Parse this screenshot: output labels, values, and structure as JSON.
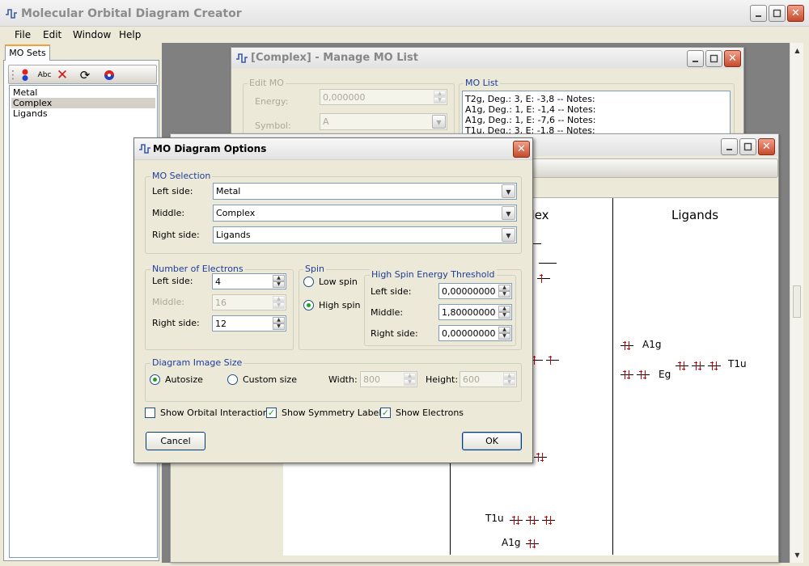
{
  "app": {
    "title": "Molecular Orbital Diagram Creator"
  },
  "menu": [
    "File",
    "Edit",
    "Window",
    "Help"
  ],
  "left_panel": {
    "tab": "MO Sets",
    "toolbar": {
      "abc_label": "Abc"
    },
    "sets": [
      "Metal",
      "Complex",
      "Ligands"
    ],
    "selected": "Complex"
  },
  "manage_window": {
    "title": "[Complex] - Manage MO List",
    "edit_group": "Edit MO",
    "energy_label": "Energy:",
    "energy_value": "0,000000",
    "symbol_label": "Symbol:",
    "symbol_value": "A",
    "list_group": "MO List",
    "mo_list": [
      "T2g, Deg.: 3, E: -3,8  -- Notes:",
      "A1g, Deg.: 1, E: -1,4  -- Notes:",
      "A1g, Deg.: 1, E: -7,6  -- Notes:",
      "T1u, Deg.: 3, E: -1,8  -- Notes:"
    ]
  },
  "diagram": {
    "headings": {
      "middle": "plex",
      "right": "Ligands"
    },
    "labels": {
      "a1g_right": "A1g",
      "eg_right": "Eg",
      "t1u_right": "T1u",
      "t1u_bottom": "T1u",
      "a1g_bottom": "A1g"
    }
  },
  "dialog": {
    "title": "MO Diagram Options",
    "mo_selection": {
      "title": "MO Selection",
      "left_label": "Left side:",
      "left_value": "Metal",
      "middle_label": "Middle:",
      "middle_value": "Complex",
      "right_label": "Right side:",
      "right_value": "Ligands"
    },
    "electrons": {
      "title": "Number of Electrons",
      "left_label": "Left side:",
      "left_value": "4",
      "middle_label": "Middle:",
      "middle_value": "16",
      "right_label": "Right side:",
      "right_value": "12"
    },
    "spin": {
      "title": "Spin",
      "low_label": "Low spin",
      "high_label": "High spin",
      "selected": "High spin",
      "threshold_title": "High Spin Energy Threshold",
      "left_label": "Left side:",
      "left_value": "0,00000000",
      "middle_label": "Middle:",
      "middle_value": "1,80000000",
      "right_label": "Right side:",
      "right_value": "0,00000000"
    },
    "image_size": {
      "title": "Diagram Image Size",
      "autosize_label": "Autosize",
      "custom_label": "Custom size",
      "selected": "Autosize",
      "width_label": "Width:",
      "width_value": "800",
      "height_label": "Height:",
      "height_value": "600"
    },
    "checks": {
      "interactions_label": "Show Orbital Interactions",
      "interactions": false,
      "symmetry_label": "Show Symmetry Labels",
      "symmetry": true,
      "electrons_label": "Show Electrons",
      "electrons": true
    },
    "cancel_label": "Cancel",
    "ok_label": "OK"
  }
}
